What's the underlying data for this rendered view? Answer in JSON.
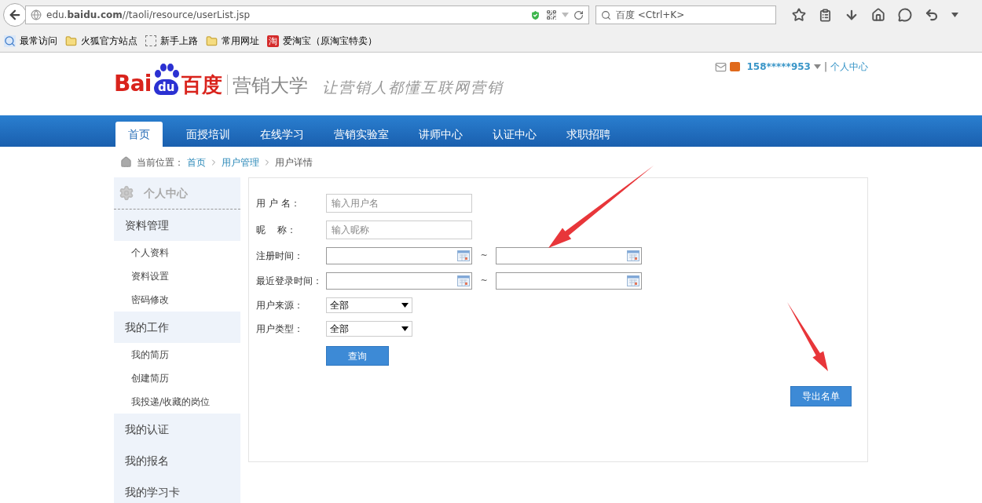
{
  "browser": {
    "url": "edu.**baidu.com**//taoli/resource/userList.jsp",
    "search_placeholder": "百度 <Ctrl+K>",
    "bookmarks": [
      {
        "kind": "search",
        "label": "最常访问"
      },
      {
        "kind": "folder",
        "label": "火狐官方站点"
      },
      {
        "kind": "blank",
        "label": "新手上路"
      },
      {
        "kind": "folder",
        "label": "常用网址"
      },
      {
        "kind": "badge",
        "badge": "淘",
        "label": "爱淘宝（原淘宝特卖）"
      }
    ]
  },
  "user_bar": {
    "account": "158*****953",
    "separator": "|",
    "link": "个人中心"
  },
  "logo": {
    "brand_left": "Bai",
    "brand_paw": "du",
    "brand_cn": "百度",
    "site": "营销大学",
    "slogan": "让营销人都懂互联网营销"
  },
  "nav": [
    {
      "label": "首页",
      "selected": true
    },
    {
      "label": "面授培训",
      "selected": false
    },
    {
      "label": "在线学习",
      "selected": false
    },
    {
      "label": "营销实验室",
      "selected": false
    },
    {
      "label": "讲师中心",
      "selected": false
    },
    {
      "label": "认证中心",
      "selected": false
    },
    {
      "label": "求职招聘",
      "selected": false
    }
  ],
  "breadcrumb": {
    "label": "当前位置：",
    "items": [
      {
        "kind": "link",
        "text": "首页"
      },
      {
        "kind": "link",
        "text": "用户管理"
      },
      {
        "kind": "current",
        "text": "用户详情"
      }
    ]
  },
  "sidebar": {
    "title": "个人中心",
    "groups": [
      {
        "label": "资料管理",
        "items": [
          "个人资料",
          "资料设置",
          "密码修改"
        ]
      },
      {
        "label": "我的工作",
        "items": [
          "我的简历",
          "创建简历",
          "我投递/收藏的岗位"
        ]
      },
      {
        "label": "我的认证"
      },
      {
        "label": "我的报名"
      },
      {
        "label": "我的学习卡"
      }
    ]
  },
  "form": [
    {
      "kind": "text",
      "label": "用 户 名：",
      "placeholder": "输入用户名"
    },
    {
      "kind": "text",
      "label": "昵    称：",
      "placeholder": "输入昵称"
    },
    {
      "kind": "daterange",
      "label": "注册时间：",
      "separator": "~"
    },
    {
      "kind": "daterange",
      "label": "最近登录时间：",
      "separator": "~"
    },
    {
      "kind": "select",
      "label": "用户来源：",
      "value": "全部"
    },
    {
      "kind": "select",
      "label": "用户类型：",
      "value": "全部"
    },
    {
      "kind": "button",
      "label": "查询"
    }
  ],
  "export_button": "导出名单"
}
